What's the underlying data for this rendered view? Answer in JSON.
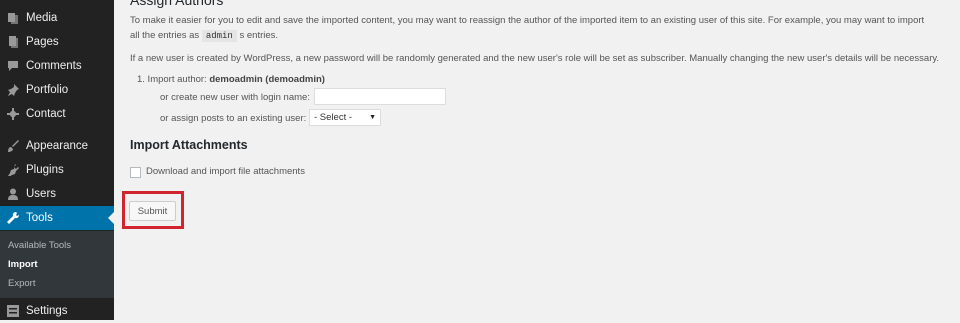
{
  "sidebar": {
    "items": [
      {
        "label": "Media",
        "icon": "media-icon"
      },
      {
        "label": "Pages",
        "icon": "pages-icon"
      },
      {
        "label": "Comments",
        "icon": "comments-icon"
      },
      {
        "label": "Portfolio",
        "icon": "portfolio-icon"
      },
      {
        "label": "Contact",
        "icon": "contact-icon"
      },
      {
        "label": "Appearance",
        "icon": "appearance-icon"
      },
      {
        "label": "Plugins",
        "icon": "plugins-icon"
      },
      {
        "label": "Users",
        "icon": "users-icon"
      },
      {
        "label": "Tools",
        "icon": "tools-icon",
        "active": true
      },
      {
        "label": "Settings",
        "icon": "settings-icon"
      }
    ],
    "submenu": [
      {
        "label": "Available Tools"
      },
      {
        "label": "Import",
        "current": true
      },
      {
        "label": "Export"
      }
    ]
  },
  "main": {
    "heading": "Assign Authors",
    "intro_part1": "To make it easier for you to edit and save the imported content, you may want to reassign the author of the imported item to an existing user of this site. For example, you may want to import",
    "intro_part2_before": "all the entries as",
    "intro_code": "admin",
    "intro_part2_after": "s entries.",
    "new_user_note": "If a new user is created by WordPress, a new password will be randomly generated and the new user's role will be set as subscriber. Manually changing the new user's details will be necessary.",
    "import_author_prefix": "1.  Import author:",
    "import_author_name": "demoadmin (demoadmin)",
    "create_user_label": "or create new user with login name:",
    "create_user_value": "",
    "assign_label": "or assign posts to an existing user:",
    "assign_selected": "- Select -",
    "attachments_heading": "Import Attachments",
    "attachments_checkbox_label": "Download and import file attachments",
    "attachments_checked": false,
    "submit_label": "Submit"
  },
  "colors": {
    "sidebar_bg": "#222222",
    "active_bg": "#0073aa",
    "highlight_border": "#d0242f"
  }
}
